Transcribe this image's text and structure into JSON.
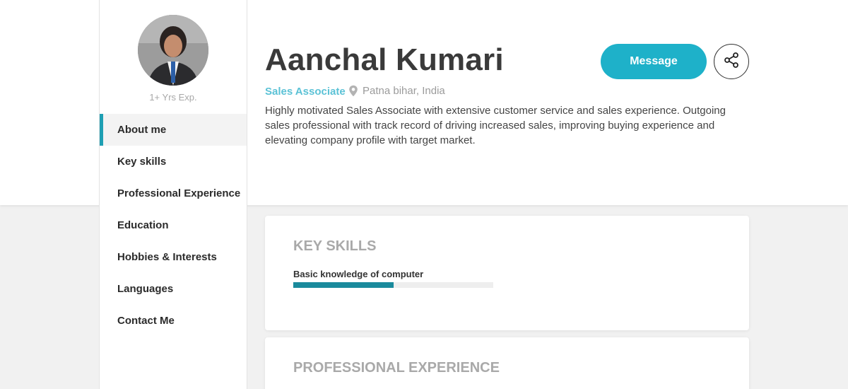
{
  "profile": {
    "experience": "1+ Yrs Exp.",
    "name": "Aanchal Kumari",
    "title": "Sales Associate",
    "location": "Patna bihar, India",
    "summary": "Highly motivated Sales Associate with extensive customer service and sales experience. Outgoing sales professional with track record of driving increased sales, improving buying experience and elevating company profile with target market."
  },
  "actions": {
    "message_label": "Message",
    "share_icon": "share-icon"
  },
  "nav": {
    "items": [
      {
        "label": "About me",
        "active": true
      },
      {
        "label": "Key skills",
        "active": false
      },
      {
        "label": "Professional Experience",
        "active": false
      },
      {
        "label": "Education",
        "active": false
      },
      {
        "label": "Hobbies & Interests",
        "active": false
      },
      {
        "label": "Languages",
        "active": false
      },
      {
        "label": "Contact Me",
        "active": false
      }
    ]
  },
  "sections": {
    "key_skills": {
      "heading": "KEY SKILLS",
      "skills": [
        {
          "name": "Basic knowledge of computer",
          "level": 0.5
        }
      ]
    },
    "professional_experience": {
      "heading": "PROFESSIONAL EXPERIENCE"
    }
  },
  "colors": {
    "accent": "#1eb1c9",
    "skill_bar": "#1a8a9c",
    "title_text": "#5bc2d6"
  }
}
